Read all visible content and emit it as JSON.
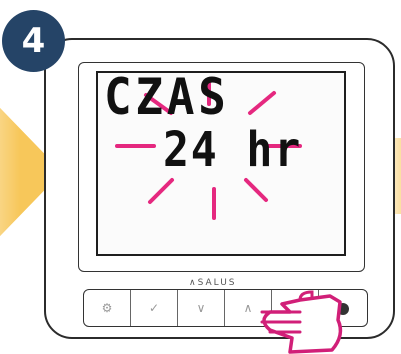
{
  "step": {
    "number": "4"
  },
  "display": {
    "line1": "CZAS",
    "line2": "24 hr"
  },
  "device": {
    "brand": "SALUS"
  },
  "buttons": [
    {
      "icon": "gear-icon",
      "glyph": "⚙"
    },
    {
      "icon": "check-icon",
      "glyph": "✓"
    },
    {
      "icon": "chevron-down-icon",
      "glyph": "∨"
    },
    {
      "icon": "chevron-up-icon",
      "glyph": "∧"
    },
    {
      "icon": "back-icon",
      "glyph": ""
    },
    {
      "icon": "power-icon",
      "glyph": ""
    }
  ],
  "colors": {
    "accent_pink": "#e5287f",
    "badge_blue": "#254467",
    "arrow_yellow": "#f7c552"
  }
}
